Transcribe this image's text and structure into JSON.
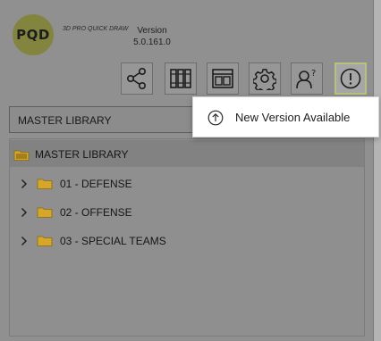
{
  "app": {
    "logo_text": "PQD",
    "tagline": "3D PRO QUICK DRAW",
    "version_label": "Version",
    "version_number": "5.0.161.0"
  },
  "toolbar": {
    "buttons": [
      {
        "name": "share",
        "icon": "share-icon"
      },
      {
        "name": "library",
        "icon": "library-books-icon"
      },
      {
        "name": "layout",
        "icon": "layout-icon"
      },
      {
        "name": "settings",
        "icon": "gear-icon"
      },
      {
        "name": "help",
        "icon": "help-person-icon"
      },
      {
        "name": "alert",
        "icon": "exclamation-circle-icon",
        "active": true
      }
    ]
  },
  "library_select": {
    "value": "MASTER LIBRARY"
  },
  "tree": {
    "root_label": "MASTER LIBRARY",
    "items": [
      {
        "label": "01 - DEFENSE"
      },
      {
        "label": "02 - OFFENSE"
      },
      {
        "label": "03 - SPECIAL TEAMS"
      }
    ]
  },
  "popup": {
    "item_label": "New Version Available",
    "icon": "upload-arrow-circle-icon"
  },
  "colors": {
    "folder": "#d4a62a",
    "logo": "#83853f",
    "active_border": "#b9c27a"
  }
}
